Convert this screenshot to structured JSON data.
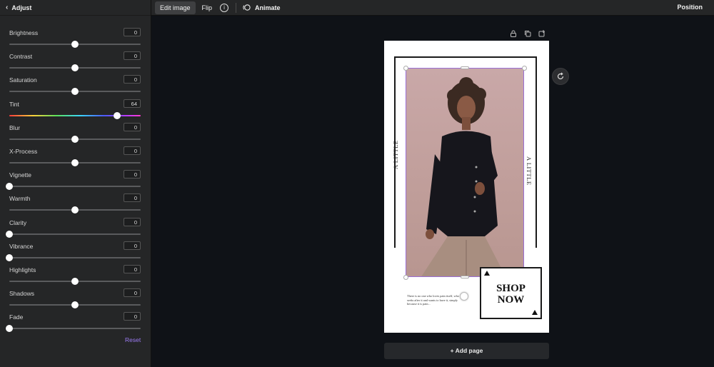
{
  "panel": {
    "back_icon": "chevron-left-icon",
    "title": "Adjust",
    "sliders": [
      {
        "label": "Brightness",
        "value": "0",
        "fraction": 0.5
      },
      {
        "label": "Contrast",
        "value": "0",
        "fraction": 0.5
      },
      {
        "label": "Saturation",
        "value": "0",
        "fraction": 0.5
      },
      {
        "label": "Tint",
        "value": "64",
        "fraction": 0.82,
        "gradient": true
      },
      {
        "label": "Blur",
        "value": "0",
        "fraction": 0.5
      },
      {
        "label": "X-Process",
        "value": "0",
        "fraction": 0.5
      },
      {
        "label": "Vignette",
        "value": "0",
        "fraction": 0.0
      },
      {
        "label": "Warmth",
        "value": "0",
        "fraction": 0.5
      },
      {
        "label": "Clarity",
        "value": "0",
        "fraction": 0.0
      },
      {
        "label": "Vibrance",
        "value": "0",
        "fraction": 0.0
      },
      {
        "label": "Highlights",
        "value": "0",
        "fraction": 0.5
      },
      {
        "label": "Shadows",
        "value": "0",
        "fraction": 0.5
      },
      {
        "label": "Fade",
        "value": "0",
        "fraction": 0.0
      }
    ],
    "reset_label": "Reset",
    "accent_color": "#9c7bf2"
  },
  "toolbar": {
    "edit_image_label": "Edit image",
    "flip_label": "Flip",
    "info_icon": "info-icon",
    "animate_label": "Animate",
    "position_label": "Position"
  },
  "canvas": {
    "page_tools": [
      "lock-icon",
      "duplicate-icon",
      "add-page-icon"
    ],
    "refresh_icon": "refresh-icon",
    "design": {
      "vertical_text_left": "A LITTLE",
      "vertical_text_right": "A LITTLE",
      "shop_line1": "SHOP",
      "shop_line2": "NOW",
      "body_text": "There is no one who loves pain itself, who seeks after it and wants to have it, simply because it is pain..."
    },
    "add_page_label": "+ Add page"
  }
}
